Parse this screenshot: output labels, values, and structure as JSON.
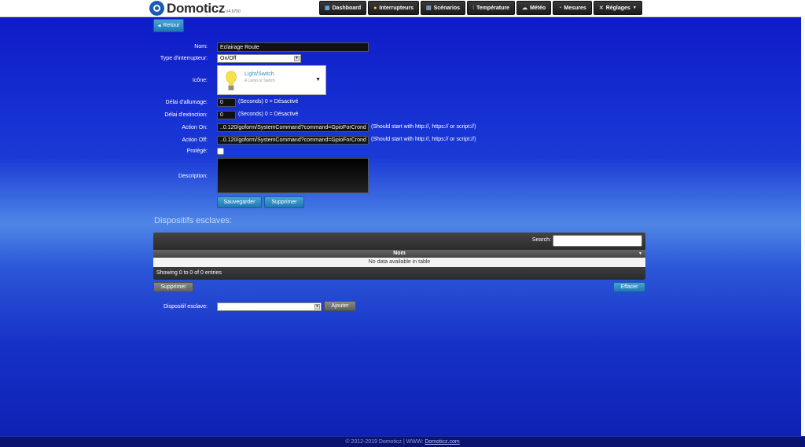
{
  "header": {
    "brand": "Domoticz",
    "version": "V4.9700",
    "nav": [
      {
        "label": "Dashboard",
        "icon": "dashboard-icon"
      },
      {
        "label": "Interrupteurs",
        "icon": "lightbulb-icon"
      },
      {
        "label": "Scénarios",
        "icon": "scenes-icon"
      },
      {
        "label": "Température",
        "icon": "thermometer-icon"
      },
      {
        "label": "Météo",
        "icon": "weather-icon"
      },
      {
        "label": "Mesures",
        "icon": "measure-icon"
      },
      {
        "label": "Réglages",
        "icon": "tools-icon"
      }
    ]
  },
  "back_button": "Retour",
  "form": {
    "name_label": "Nom:",
    "name_value": "Eclairage Route",
    "switch_type_label": "Type d'interrupteur:",
    "switch_type_value": "On/Off",
    "icon_label": "Icône:",
    "icon_title": "Light/Switch",
    "icon_subtitle": "A Lamp or Switch",
    "on_delay_label": "Délai d'allumage:",
    "on_delay_value": "0",
    "on_delay_hint": "(Seconds) 0 = Désactivé",
    "off_delay_label": "Délai d'extinction:",
    "off_delay_value": "0",
    "off_delay_hint": "(Seconds) 0 = Désactivé",
    "action_on_label": "Action On:",
    "action_on_value": "..0.120/goform/SystemCommand?command=GpioForCrond",
    "action_on_hint": "(Should start with http://, https:// or script://)",
    "action_off_label": "Action Off:",
    "action_off_value": "..0.120/goform/SystemCommand?command=GpioForCrond",
    "action_off_hint": "(Should start with http://, https:// or script://)",
    "protected_label": "Protégé:",
    "description_label": "Description:",
    "save_button": "Sauvegarder",
    "delete_button": "Supprimer"
  },
  "slaves": {
    "title": "Dispositifs esclaves:",
    "search_label": "Search:",
    "column": "Nom",
    "empty": "No data available in table",
    "info": "Showing 0 to 0 of 0 entries",
    "delete_button": "Supprimer",
    "clear_button": "Effacer",
    "slave_label": "Dispositif esclave:",
    "add_button": "Ajouter"
  },
  "footer": {
    "text": "© 2012-2019 Domoticz | WWW:",
    "link": "Domoticz.com"
  }
}
